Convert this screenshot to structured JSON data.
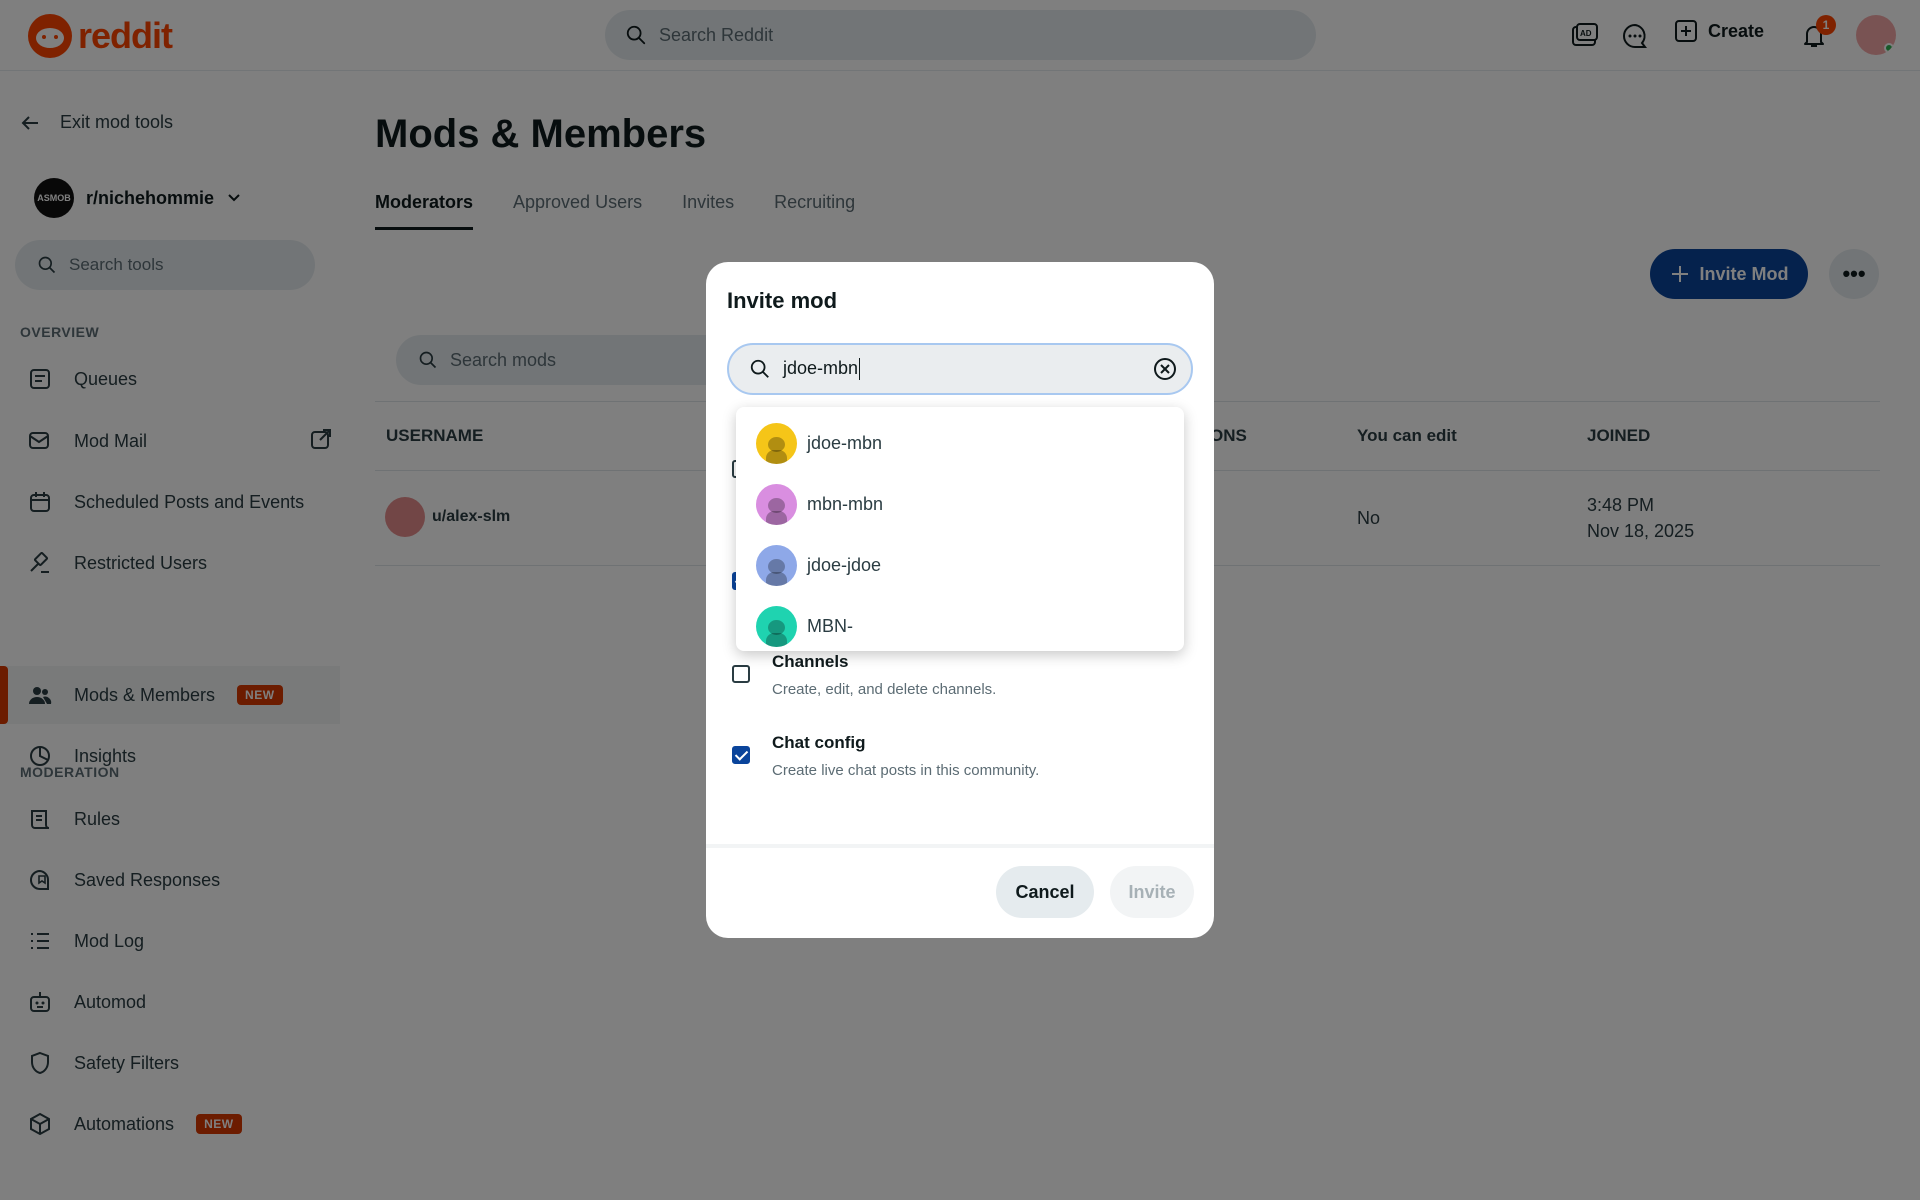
{
  "header": {
    "logo_text": "reddit",
    "search_placeholder": "Search Reddit",
    "create_label": "Create",
    "notification_count": "1",
    "icons": [
      "advertise-icon",
      "chat-icon",
      "plus-square-icon",
      "bell-icon"
    ]
  },
  "sidebar": {
    "exit_label": "Exit mod tools",
    "community_name": "r/nichehommie",
    "community_avatar_text": "ASMOB",
    "search_tools_placeholder": "Search tools",
    "overview_title": "OVERVIEW",
    "overview_items": [
      {
        "label": "Queues",
        "icon": "queue-icon"
      },
      {
        "label": "Mod Mail",
        "icon": "modmail-icon"
      },
      {
        "label": "Scheduled Posts and Events",
        "icon": "calendar-icon"
      },
      {
        "label": "Restricted Users",
        "icon": "hammer-icon"
      },
      {
        "label": "Mods & Members",
        "icon": "users-icon",
        "badge": "NEW",
        "active": true
      },
      {
        "label": "Insights",
        "icon": "chart-pie-icon"
      }
    ],
    "moderation_title": "MODERATION",
    "moderation_items": [
      {
        "label": "Rules",
        "icon": "rules-icon"
      },
      {
        "label": "Saved Responses",
        "icon": "saved-response-icon"
      },
      {
        "label": "Mod Log",
        "icon": "list-icon"
      },
      {
        "label": "Automod",
        "icon": "robot-icon"
      },
      {
        "label": "Safety Filters",
        "icon": "shield-icon"
      },
      {
        "label": "Automations",
        "icon": "cube-icon",
        "badge": "NEW"
      }
    ]
  },
  "main": {
    "title": "Mods & Members",
    "tabs": [
      "Moderators",
      "Approved Users",
      "Invites",
      "Recruiting"
    ],
    "invite_mod_label": "Invite Mod",
    "search_mods_placeholder": "Search mods",
    "table": {
      "columns": [
        "USERNAME",
        "ONS",
        "You can edit",
        "JOINED"
      ],
      "rows": [
        {
          "username": "u/alex-slm",
          "can_edit": "No",
          "joined_time": "3:48 PM",
          "joined_date": "Nov 18, 2025"
        }
      ]
    }
  },
  "modal": {
    "title": "Invite mod",
    "search_value": "jdoe-mbn",
    "suggestions": [
      {
        "name": "jdoe-mbn",
        "color": "#f5c518"
      },
      {
        "name": "mbn-mbn",
        "color": "#d98ee0"
      },
      {
        "name": "jdoe-jdoe",
        "color": "#8ea8e8"
      },
      {
        "name": "MBN-",
        "color": "#1fd3b0"
      }
    ],
    "permissions": [
      {
        "title": "Channels",
        "desc": "Create, edit, and delete channels.",
        "checked": false
      },
      {
        "title": "Chat config",
        "desc": "Create live chat posts in this community.",
        "checked": true
      }
    ],
    "cancel_label": "Cancel",
    "invite_label": "Invite"
  },
  "colors": {
    "brand": "#ff4500",
    "primary_button": "#0a449b",
    "new_badge": "#d93900"
  }
}
